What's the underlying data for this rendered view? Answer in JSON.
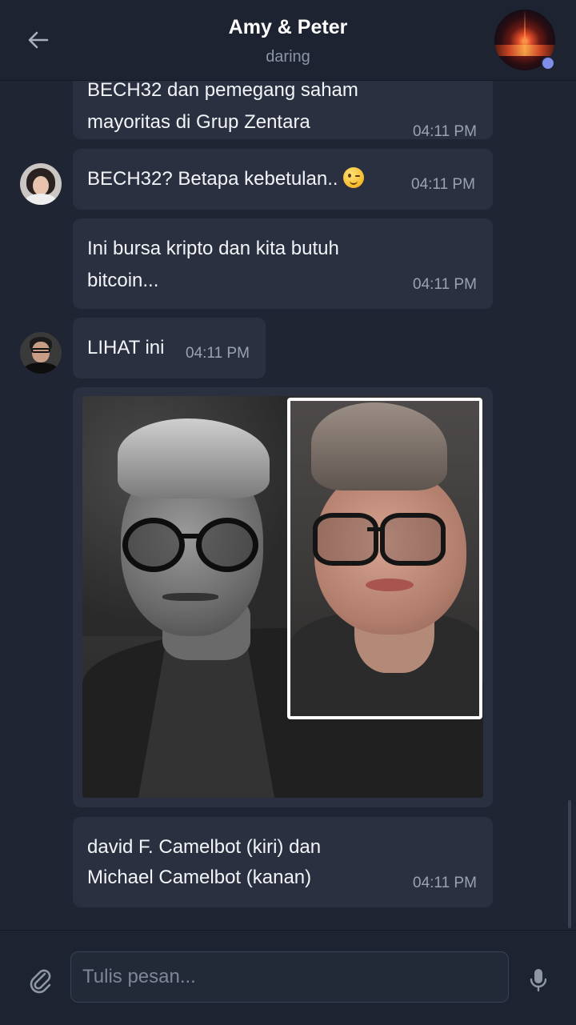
{
  "header": {
    "title": "Amy & Peter",
    "status": "daring"
  },
  "messages": [
    {
      "text_lines": [
        "BECH32 dan pemegang saham",
        "mayoritas di Grup Zentara"
      ],
      "time": "04:11 PM",
      "sender": "Amy"
    },
    {
      "text": "BECH32? Betapa kebetulan..",
      "emoji": "wink-emoji",
      "time": "04:11 PM",
      "sender": "Amy"
    },
    {
      "text_lines": [
        "Ini bursa kripto dan kita butuh",
        "bitcoin..."
      ],
      "time": "04:11 PM",
      "sender": "Amy"
    },
    {
      "text": "LIHAT ini",
      "time": "04:11 PM",
      "sender": "Peter"
    },
    {
      "image": "photo-comparison",
      "sender": "Peter"
    },
    {
      "text_lines": [
        "david F. Camelbot (kiri) dan",
        "Michael Camelbot (kanan)"
      ],
      "time": "04:11 PM",
      "sender": "Peter"
    }
  ],
  "composer": {
    "placeholder": "Tulis pesan...",
    "attach_icon": "paperclip-icon",
    "mic_icon": "microphone-icon"
  },
  "colors": {
    "background": "#1f2533",
    "bubble": "#2a3040",
    "header": "#1d2330",
    "online": "#7f8ee8"
  }
}
